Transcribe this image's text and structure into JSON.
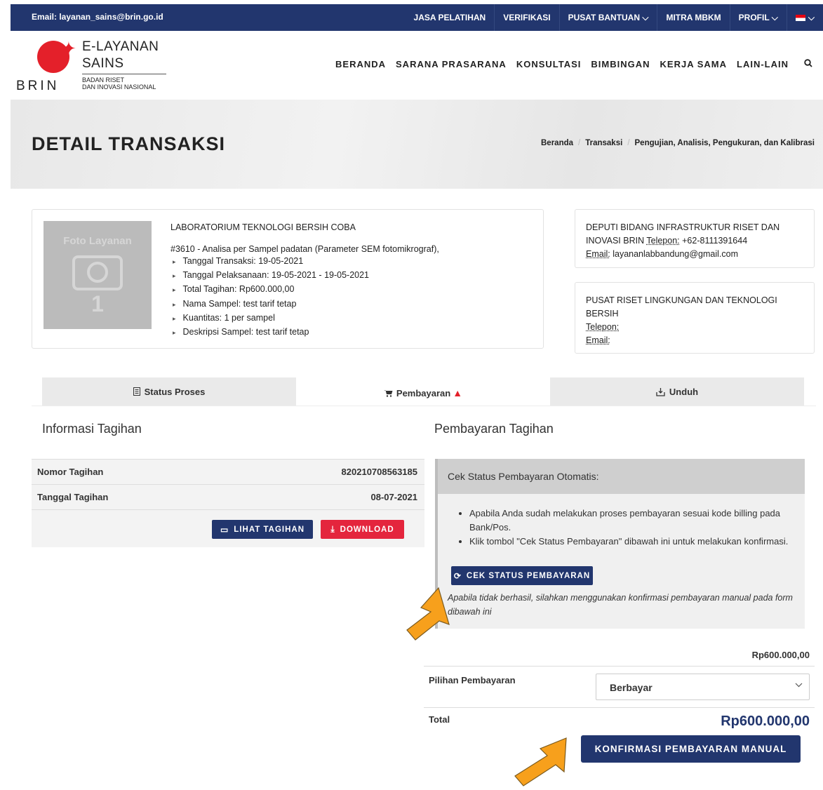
{
  "topbar": {
    "email": "Email: layanan_sains@brin.go.id",
    "items": [
      "JASA PELATIHAN",
      "VERIFIKASI",
      "PUSAT BANTUAN ⌵",
      "MITRA MBKM",
      "PROFIL ⌵",
      "⌵"
    ]
  },
  "logo": {
    "line1": "E-LAYANAN",
    "line2": "SAINS",
    "brin": "BRIN",
    "sub1": "BADAN RISET",
    "sub2": "DAN INOVASI NASIONAL"
  },
  "nav": [
    "BERANDA",
    "SARANA PRASARANA",
    "KONSULTASI",
    "BIMBINGAN",
    "KERJA SAMA",
    "LAIN-LAIN"
  ],
  "hero": {
    "title": "DETAIL TRANSAKSI",
    "breadcrumb": [
      "Beranda",
      "Transaksi",
      "Pengujian, Analisis, Pengukuran, dan Kalibrasi"
    ]
  },
  "service": {
    "image_label": "Foto Layanan",
    "image_num": "1",
    "lab": "LABORATORIUM TEKNOLOGI BERSIH COBA",
    "title": "#3610 - Analisa per Sampel padatan (Parameter SEM fotomikrograf),",
    "details": [
      "Tanggal Transaksi: 19-05-2021",
      "Tanggal Pelaksanaan: 19-05-2021 - 19-05-2021",
      "Total Tagihan: Rp600.000,00",
      "Nama Sampel: test tarif tetap",
      "Kuantitas: 1 per sampel",
      "Deskripsi Sampel: test tarif tetap"
    ]
  },
  "contact1": {
    "org": "DEPUTI BIDANG INFRASTRUKTUR RISET DAN INOVASI BRIN",
    "phone_label": "Telepon:",
    "phone": "+62-8111391644",
    "email_label": "Email:",
    "email": "layananlabbandung@gmail.com"
  },
  "contact2": {
    "org": "PUSAT RISET LINGKUNGAN DAN TEKNOLOGI BERSIH",
    "phone_label": "Telepon:",
    "email_label": "Email:"
  },
  "tabs": [
    "Status Proses",
    "Pembayaran",
    "Unduh"
  ],
  "invoice": {
    "heading": "Informasi Tagihan",
    "number_label": "Nomor Tagihan",
    "number": "820210708563185",
    "date_label": "Tanggal Tagihan",
    "date": "08-07-2021",
    "view_btn": "LIHAT TAGIHAN",
    "download_btn": "DOWNLOAD"
  },
  "payment": {
    "heading": "Pembayaran Tagihan",
    "auto_title": "Cek Status Pembayaran Otomatis:",
    "bullets": [
      "Apabila Anda sudah melakukan proses pembayaran sesuai kode billing pada Bank/Pos.",
      "Klik tombol \"Cek Status Pembayaran\" dibawah ini untuk melakukan konfirmasi."
    ],
    "check_btn": "CEK STATUS PEMBAYARAN",
    "note": "Apabila tidak berhasil, silahkan menggunakan konfirmasi pembayaran manual pada form dibawah ini",
    "amount": "Rp600.000,00",
    "option_label": "Pilihan Pembayaran",
    "option_value": "Berbayar",
    "total_label": "Total",
    "total": "Rp600.000,00",
    "manual_btn": "KONFIRMASI PEMBAYARAN MANUAL"
  },
  "colors": {
    "navy": "#22366e",
    "red": "#e4253d",
    "arrow": "#f7a01c"
  }
}
